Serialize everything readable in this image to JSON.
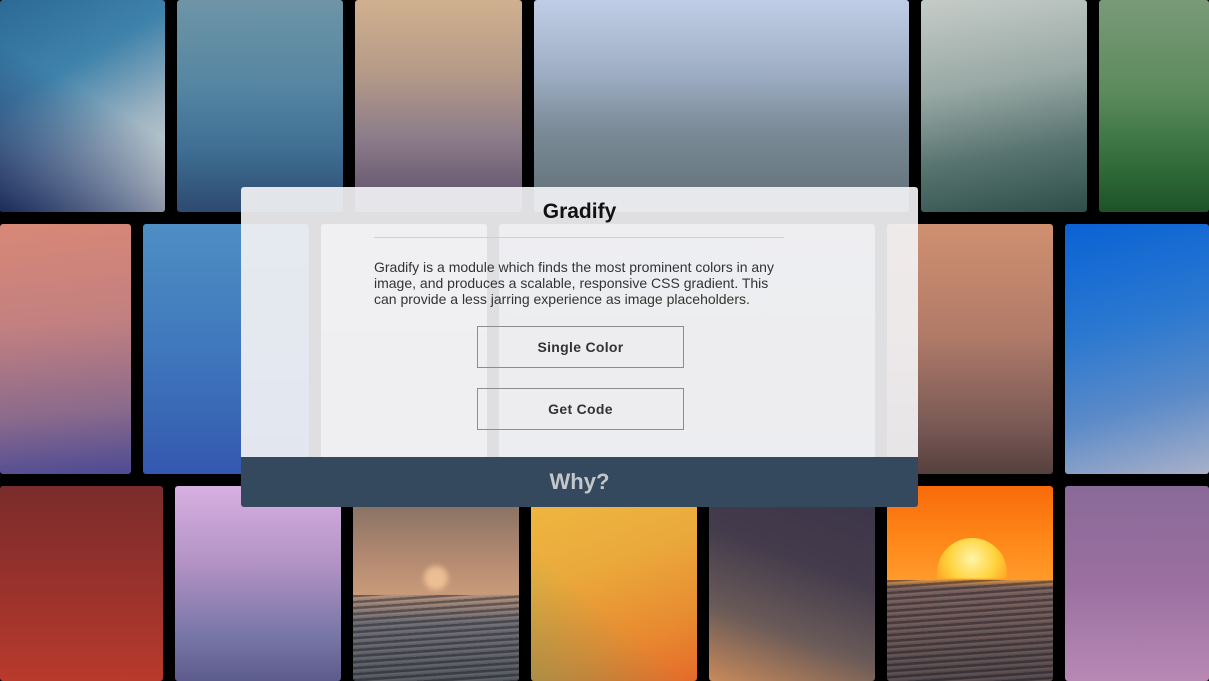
{
  "modal": {
    "title": "Gradify",
    "description": "Gradify is a module which finds the most prominent colors in any image, and produces a scalable, responsive CSS gradient. This can provide a less jarring experience as image placeholders.",
    "single_color_label": "Single Color",
    "get_code_label": "Get Code",
    "why_label": "Why?"
  },
  "colors": {
    "footer": "#35495e",
    "modal_background": "#f2f2f4",
    "page_background": "#000000"
  }
}
